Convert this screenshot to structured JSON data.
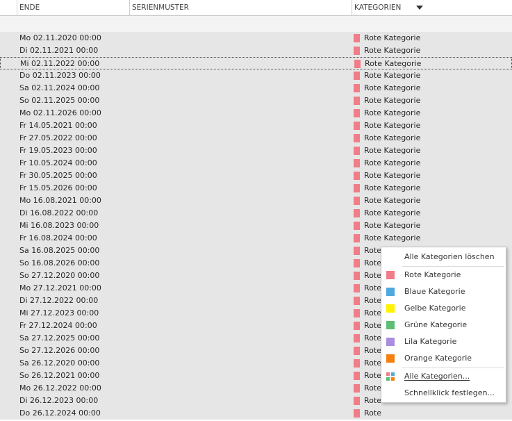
{
  "header": {
    "col_ende": "ENDE",
    "col_serienmuster": "SERIENMUSTER",
    "col_kategorien": "KATEGORIEN"
  },
  "rows": [
    {
      "date": "Mo 02.11.2020 00:00",
      "category": "Rote Kategorie"
    },
    {
      "date": "Di 02.11.2021 00:00",
      "category": "Rote Kategorie"
    },
    {
      "date": "Mi 02.11.2022 00:00",
      "category": "Rote Kategorie",
      "selected": true
    },
    {
      "date": "Do 02.11.2023 00:00",
      "category": "Rote Kategorie"
    },
    {
      "date": "Sa 02.11.2024 00:00",
      "category": "Rote Kategorie"
    },
    {
      "date": "So 02.11.2025 00:00",
      "category": "Rote Kategorie"
    },
    {
      "date": "Mo 02.11.2026 00:00",
      "category": "Rote Kategorie"
    },
    {
      "date": "Fr 14.05.2021 00:00",
      "category": "Rote Kategorie"
    },
    {
      "date": "Fr 27.05.2022 00:00",
      "category": "Rote Kategorie"
    },
    {
      "date": "Fr 19.05.2023 00:00",
      "category": "Rote Kategorie"
    },
    {
      "date": "Fr 10.05.2024 00:00",
      "category": "Rote Kategorie"
    },
    {
      "date": "Fr 30.05.2025 00:00",
      "category": "Rote Kategorie"
    },
    {
      "date": "Fr 15.05.2026 00:00",
      "category": "Rote Kategorie"
    },
    {
      "date": "Mo 16.08.2021 00:00",
      "category": "Rote Kategorie"
    },
    {
      "date": "Di 16.08.2022 00:00",
      "category": "Rote Kategorie"
    },
    {
      "date": "Mi 16.08.2023 00:00",
      "category": "Rote Kategorie"
    },
    {
      "date": "Fr 16.08.2024 00:00",
      "category": "Rote Kategorie"
    },
    {
      "date": "Sa 16.08.2025 00:00",
      "category": "Rote"
    },
    {
      "date": "So 16.08.2026 00:00",
      "category": "Rote"
    },
    {
      "date": "So 27.12.2020 00:00",
      "category": "Rote"
    },
    {
      "date": "Mo 27.12.2021 00:00",
      "category": "Rote"
    },
    {
      "date": "Di 27.12.2022 00:00",
      "category": "Rote"
    },
    {
      "date": "Mi 27.12.2023 00:00",
      "category": "Rote"
    },
    {
      "date": "Fr 27.12.2024 00:00",
      "category": "Rote"
    },
    {
      "date": "Sa 27.12.2025 00:00",
      "category": "Rote"
    },
    {
      "date": "So 27.12.2026 00:00",
      "category": "Rote"
    },
    {
      "date": "Sa 26.12.2020 00:00",
      "category": "Rote"
    },
    {
      "date": "So 26.12.2021 00:00",
      "category": "Rote"
    },
    {
      "date": "Mo 26.12.2022 00:00",
      "category": "Rote"
    },
    {
      "date": "Di 26.12.2023 00:00",
      "category": "Rote"
    },
    {
      "date": "Do 26.12.2024 00:00",
      "category": "Rote"
    }
  ],
  "colors": {
    "rot": "#f07d87",
    "blau": "#4fa8e0",
    "gelb": "#fff200",
    "gruen": "#5cbf74",
    "lila": "#a98ee0",
    "orange": "#f5800f"
  },
  "menu": {
    "clear_all": "Alle Kategorien löschen",
    "rot": "Rote Kategorie",
    "blau": "Blaue Kategorie",
    "gelb": "Gelbe Kategorie",
    "gruen": "Grüne Kategorie",
    "lila": "Lila Kategorie",
    "orange": "Orange Kategorie",
    "all_categories": "Alle Kategorien...",
    "quick_click": "Schnellklick festlegen..."
  }
}
